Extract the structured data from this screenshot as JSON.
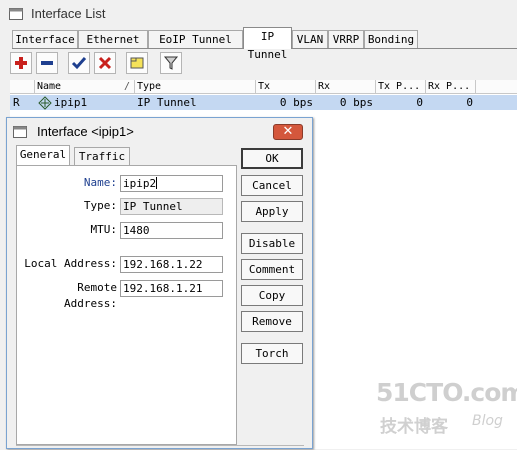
{
  "window": {
    "title": "Interface List"
  },
  "tabs": [
    "Interface",
    "Ethernet",
    "EoIP Tunnel",
    "IP Tunnel",
    "VLAN",
    "VRRP",
    "Bonding"
  ],
  "active_tab": "IP Tunnel",
  "toolbar": {
    "add": "plus-icon",
    "remove": "minus-icon",
    "enable": "check-icon",
    "disable": "cross-icon",
    "comment": "comment-icon",
    "filter": "filter-icon"
  },
  "list": {
    "columns": {
      "name": "Name",
      "type": "Type",
      "tx": "Tx",
      "rx": "Rx",
      "tx_p": "Tx P...",
      "rx_p": "Rx P..."
    },
    "rows": [
      {
        "flag": "R",
        "name": "ipip1",
        "type": "IP Tunnel",
        "tx": "0 bps",
        "rx": "0 bps",
        "tx_p": "0",
        "rx_p": "0"
      }
    ]
  },
  "dialog": {
    "title": "Interface <ipip1>",
    "close_label": "✕",
    "tabs": [
      "General",
      "Traffic"
    ],
    "fields": {
      "name_label": "Name:",
      "name_value": "ipip2",
      "type_label": "Type:",
      "type_value": "IP Tunnel",
      "mtu_label": "MTU:",
      "mtu_value": "1480",
      "local_label": "Local Address:",
      "local_value": "192.168.1.22",
      "remote_label": "Remote Address:",
      "remote_value": "192.168.1.21"
    },
    "buttons": {
      "ok": "OK",
      "cancel": "Cancel",
      "apply": "Apply",
      "disable": "Disable",
      "comment": "Comment",
      "copy": "Copy",
      "remove": "Remove",
      "torch": "Torch"
    }
  },
  "watermark": {
    "main": "51CTO.com",
    "sub": "技术博客",
    "blog": "Blog"
  },
  "colors": {
    "selected_row": "#c4d8f2",
    "label_blue": "#1e3f8f",
    "close_red": "#d4573c"
  }
}
